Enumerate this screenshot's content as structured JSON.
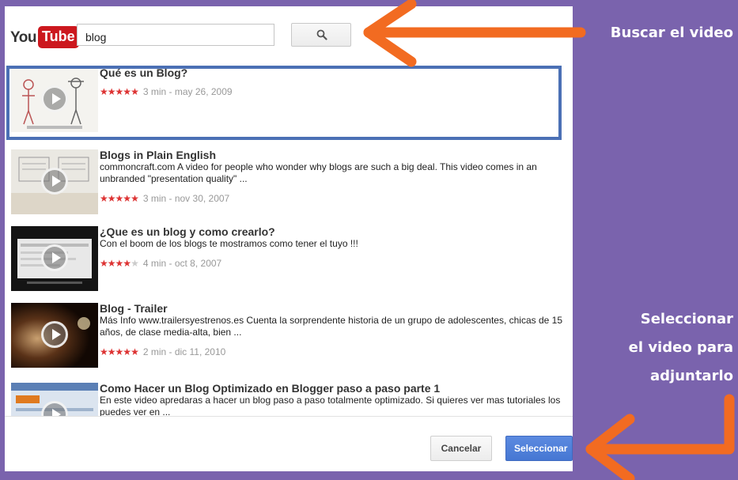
{
  "search": {
    "value": "blog",
    "brand_you": "You",
    "brand_tube": "Tube"
  },
  "results": [
    {
      "title": "Qué es un Blog?",
      "description": "",
      "stars": 4.5,
      "meta": "3 min - may 26, 2009"
    },
    {
      "title": "Blogs in Plain English",
      "description": "commoncraft.com A video for people who wonder why blogs are such a big deal. This video comes in an unbranded \"presentation quality\" ...",
      "stars": 5,
      "meta": "3 min - nov 30, 2007"
    },
    {
      "title": "¿Que es un blog y como crearlo?",
      "description": "Con el boom de los blogs te mostramos como tener el tuyo !!!",
      "stars": 4,
      "meta": "4 min - oct 8, 2007"
    },
    {
      "title": "Blog - Trailer",
      "description": "Más Info www.trailersyestrenos.es Cuenta la sorprendente historia de un grupo de adolescentes, chicas de 15 años, de clase media-alta, bien ...",
      "stars": 4.5,
      "meta": "2 min - dic 11, 2010"
    },
    {
      "title": "Como Hacer un Blog Optimizado en Blogger paso a paso parte 1",
      "description": "En este video apredaras a hacer un blog paso a paso totalmente optimizado. Si quieres ver mas tutoriales los puedes ver en ...",
      "stars": 0,
      "meta": ""
    }
  ],
  "footer": {
    "cancel_label": "Cancelar",
    "select_label": "Seleccionar"
  },
  "captions": {
    "search": "Buscar el video",
    "select_line1": "Seleccionar",
    "select_line2": "el video para",
    "select_line3": "adjuntarlo"
  },
  "colors": {
    "background": "#7a63ad",
    "arrow": "#f26b21",
    "selection": "#4b70b5",
    "stars": "#dd3333"
  },
  "icons": [
    "search-icon",
    "play-icon",
    "star-icon",
    "arrow-icon"
  ]
}
